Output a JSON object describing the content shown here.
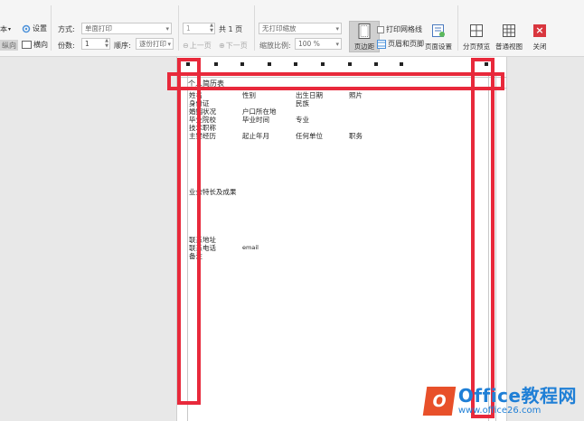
{
  "toolbar": {
    "left_cut": {
      "top_text": "本",
      "portrait": "纵向",
      "settings": "设置",
      "landscape": "横向"
    },
    "method_label": "方式:",
    "method_value": "单面打印",
    "copies_label": "份数:",
    "copies_value": "1",
    "order_label": "顺序:",
    "order_value": "逐份打印",
    "page_value": "1",
    "total_pages": "共 1 页",
    "prev_page": "上一页",
    "next_page": "下一页",
    "scale_mode": "无打印缩放",
    "zoom_label": "缩放比例:",
    "zoom_value": "100 %",
    "margins": "页边距",
    "print_gridlines": "打印网格线",
    "header_footer": "页眉和页脚",
    "page_setup": "页面设置",
    "page_break_preview": "分页预览",
    "normal_view": "普通视图",
    "close": "关闭"
  },
  "sheet": {
    "title": "个人简历表",
    "rows": [
      [
        "姓名",
        "性别",
        "出生日期",
        "照片"
      ],
      [
        "身份证",
        "",
        "民族",
        ""
      ],
      [
        "婚姻状况",
        "户口所在地",
        "",
        ""
      ],
      [
        "毕业院校",
        "毕业时间",
        "专业",
        ""
      ],
      [
        "技术职称",
        "",
        "",
        ""
      ],
      [
        "主要经历",
        "起止年月",
        "任何单位",
        "职务"
      ]
    ],
    "skills": "业余特长及成果",
    "contact_address": "联系地址",
    "contact_phone": "联系电话",
    "email": "email",
    "remarks": "备注"
  },
  "watermark": {
    "title": "Office教程网",
    "url": "www.office26.com"
  },
  "colors": {
    "highlight": "#e8293b",
    "watermark": "#1f7fd6",
    "logo": "#e8502a"
  }
}
